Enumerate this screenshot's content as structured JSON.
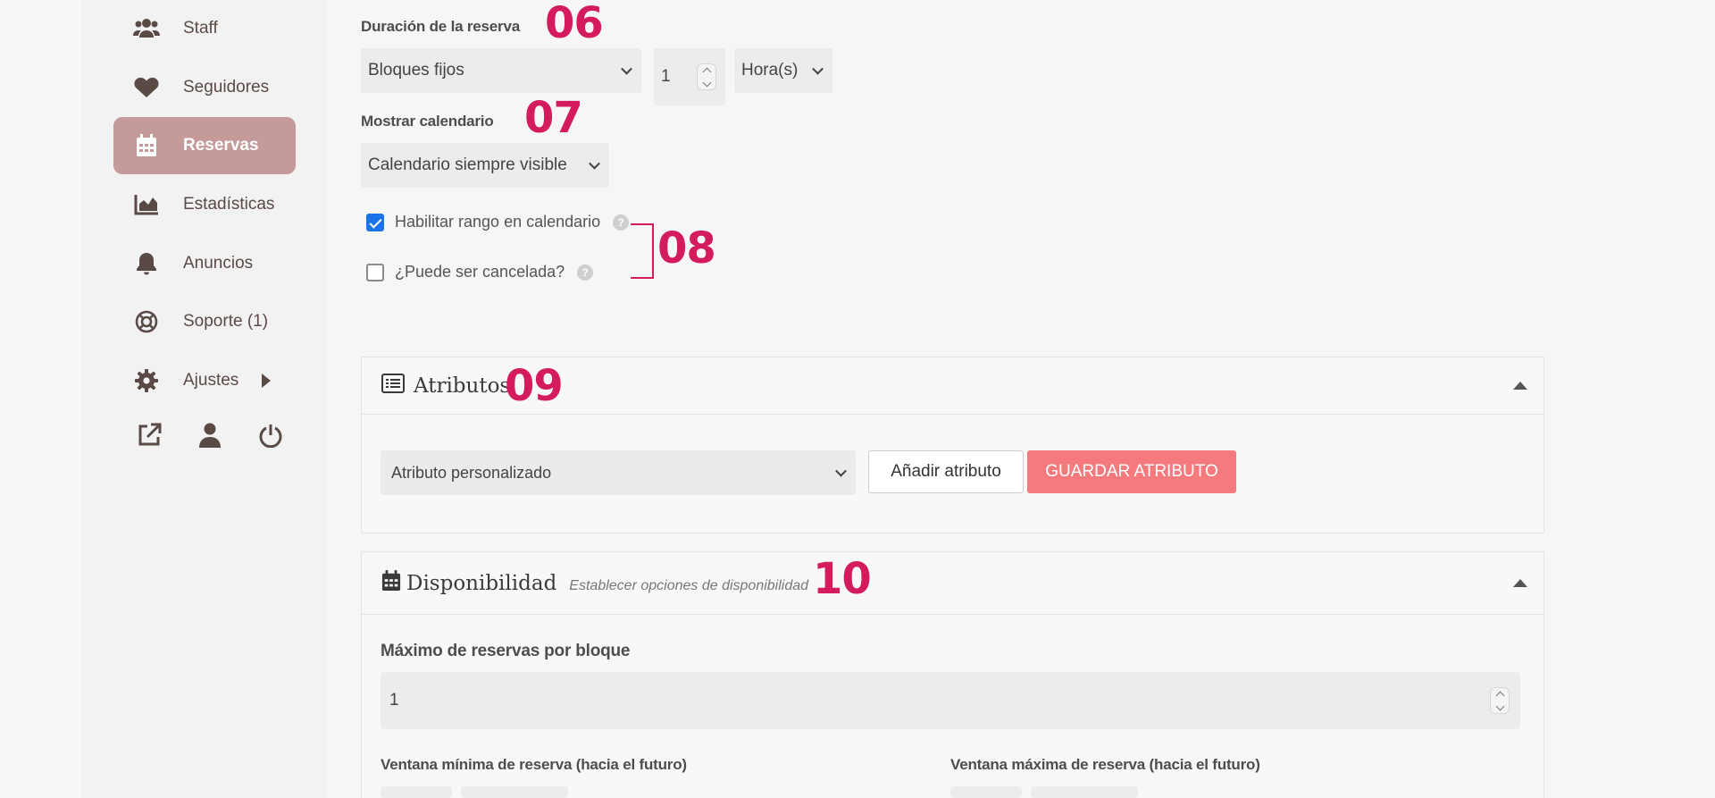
{
  "sidebar": {
    "items": [
      {
        "label": "Staff",
        "icon": "users-icon"
      },
      {
        "label": "Seguidores",
        "icon": "heart-icon"
      },
      {
        "label": "Reservas",
        "icon": "calendar-icon",
        "active": true
      },
      {
        "label": "Estadísticas",
        "icon": "area-chart-icon"
      },
      {
        "label": "Anuncios",
        "icon": "bell-icon"
      },
      {
        "label": "Soporte (1)",
        "icon": "lifebuoy-icon"
      },
      {
        "label": "Ajustes",
        "icon": "gear-icon"
      }
    ],
    "bottom_icons": [
      "external-link-icon",
      "user-icon",
      "power-icon"
    ],
    "active_color": "#c49a9a"
  },
  "form": {
    "duration": {
      "label": "Duración de la reserva",
      "tag": "06",
      "mode": "Bloques fijos",
      "amount": "1",
      "unit": "Hora(s)"
    },
    "calendar": {
      "label": "Mostrar calendario",
      "tag": "07",
      "value": "Calendario siempre visible"
    },
    "options": {
      "tag": "08",
      "range_label": "Habilitar rango en calendario",
      "range_checked": true,
      "cancel_label": "¿Puede ser cancelada?",
      "cancel_checked": false,
      "help_glyph": "?"
    }
  },
  "attributes_panel": {
    "title": "Atributos",
    "tag": "09",
    "select_value": "Atributo personalizado",
    "add_button": "Añadir atributo",
    "save_button": "GUARDAR ATRIBUTO"
  },
  "availability_panel": {
    "title": "Disponibilidad",
    "subtitle": "Establecer opciones de disponibilidad",
    "tag": "10",
    "max_label": "Máximo de reservas por bloque",
    "max_value": "1",
    "min_window_label": "Ventana mínima de reserva (hacia el futuro)",
    "max_window_label": "Ventana máxima de reserva (hacia el futuro)"
  },
  "colors": {
    "tag": "#d41b5e",
    "primary_button": "#f47a7e",
    "checkbox": "#1a73e8"
  }
}
